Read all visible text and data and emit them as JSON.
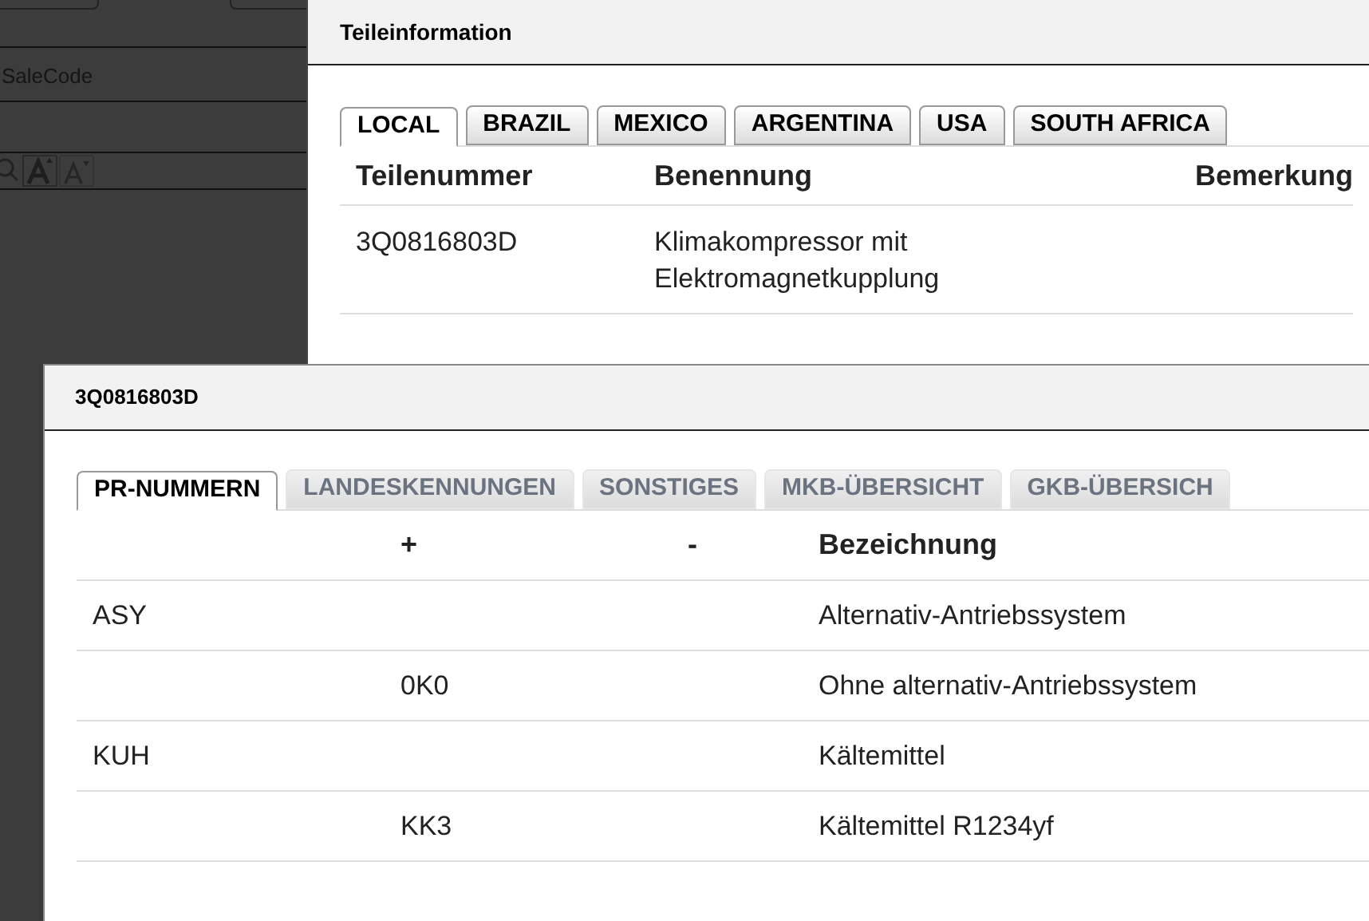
{
  "background_page": {
    "field_placeholder": "SaleCode"
  },
  "parts_dialog": {
    "title": "Teileinformation",
    "tabs": [
      {
        "label": "LOCAL",
        "selected": true
      },
      {
        "label": "BRAZIL",
        "selected": false
      },
      {
        "label": "MEXICO",
        "selected": false
      },
      {
        "label": "ARGENTINA",
        "selected": false
      },
      {
        "label": "USA",
        "selected": false
      },
      {
        "label": "SOUTH AFRICA",
        "selected": false
      }
    ],
    "table": {
      "columns": [
        "Teilenummer",
        "Benennung",
        "Bemerkung"
      ],
      "rows": [
        [
          "3Q0816803D",
          "Klimakompressor mit Elektromagnetkupplung",
          ""
        ]
      ]
    }
  },
  "detail_dialog": {
    "title": "3Q0816803D",
    "tabs": [
      {
        "label": "PR-NUMMERN",
        "selected": true
      },
      {
        "label": "LANDESKENNUNGEN",
        "selected": false
      },
      {
        "label": "SONSTIGES",
        "selected": false
      },
      {
        "label": "MKB-ÜBERSICHT",
        "selected": false
      },
      {
        "label": "GKB-ÜBERSICH",
        "selected": false
      }
    ],
    "table": {
      "columns": [
        "",
        "+",
        "-",
        "Bezeichnung"
      ],
      "rows": [
        [
          "ASY",
          "",
          "",
          "Alternativ-Antriebssystem"
        ],
        [
          "",
          "0K0",
          "",
          "Ohne alternativ-Antriebssystem"
        ],
        [
          "KUH",
          "",
          "",
          "Kältemittel"
        ],
        [
          "",
          "KK3",
          "",
          "Kältemittel R1234yf"
        ]
      ]
    }
  }
}
